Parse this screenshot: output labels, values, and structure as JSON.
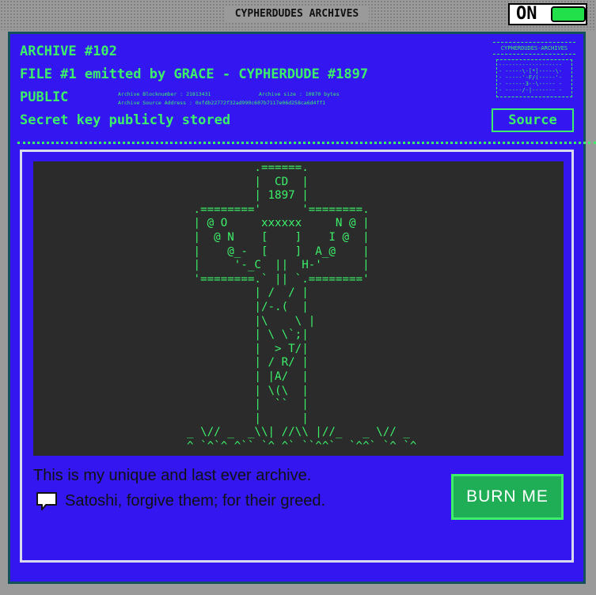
{
  "window": {
    "title": "CYPHERDUDES ARCHIVES",
    "power_label": "ON"
  },
  "header": {
    "archive_number": "ARCHIVE #102",
    "file_line": "FILE #1 emitted by GRACE - CYPHERDUDE #1897",
    "visibility": "PUBLIC",
    "secret_line": "Secret key publicly stored",
    "block_number": "Archive Blocknumber : 21813431",
    "archive_size": "Archive size : 10870 bytes",
    "source_address": "Archive Source Address : 0xfdb22772f32ad990c607b7117e06d258ca6d4ff1"
  },
  "brand": {
    "name": "CYPHERDUDES-ARCHIVES",
    "logo_text": "-------------------\n- -----\\-[*]-----\\-\n- -----'-F/(-----'-\n- ------3--\\----- -\n- -----/-|------- -"
  },
  "source_button": "Source",
  "art": {
    "text": "          .======.\n          |  CD  |\n          | 1897 |\n .========'      '========.\n | @ O     xxxxxx     N @ |\n |  @ N    [    ]    I @  |\n |    @_-  [    ]  A_@    |\n |     '-_C  ||  H-'      |\n '========.` || `.========'\n          | /  / |\n          |/-.(  |\n          |\\    \\ |\n          | \\ \\`;|\n          |  > T/|\n          | / R/ |\n          | |A/  |\n          | \\(\\  |\n          |  ``  |\n          |      |\n_ \\// _  _\\\\| //\\\\ |//_   _ \\// _\n^ `^`^ ^`` `^ ^` ``^^`  `^^` `^ `^"
  },
  "message": {
    "line1": "This is my unique and last ever archive.",
    "comment": "Satoshi, forgive them; for their greed."
  },
  "burn_button": "BURN ME",
  "colors": {
    "background_gray": "#9a9a9a",
    "frame_blue": "#3417f0",
    "terminal_green": "#3cf06a",
    "art_background": "#2b2b2b",
    "burn_button": "#1fae55"
  }
}
